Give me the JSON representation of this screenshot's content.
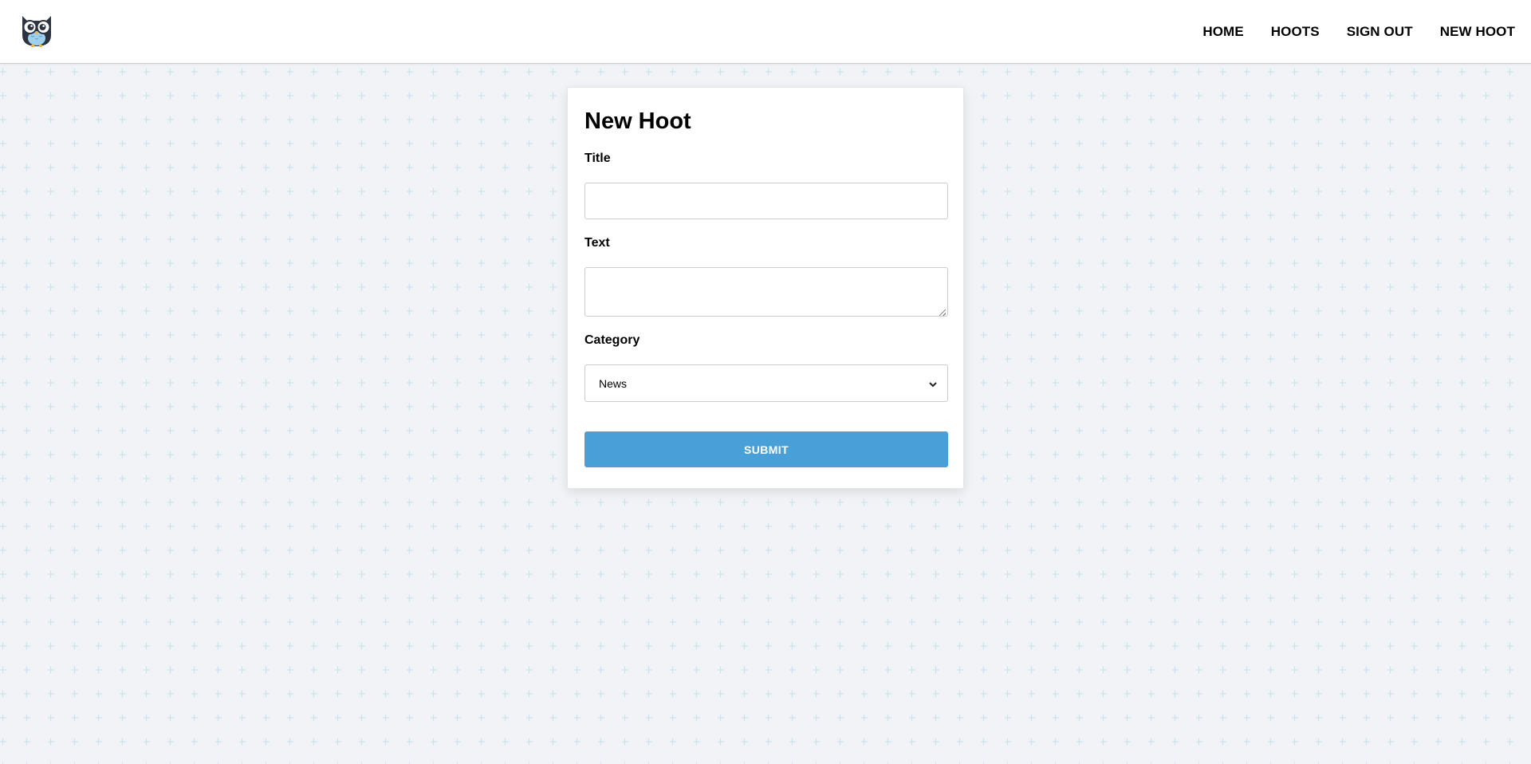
{
  "nav": {
    "items": [
      {
        "label": "HOME"
      },
      {
        "label": "HOOTS"
      },
      {
        "label": "SIGN OUT"
      },
      {
        "label": "NEW HOOT"
      }
    ]
  },
  "form": {
    "title": "New Hoot",
    "title_label": "Title",
    "title_value": "",
    "text_label": "Text",
    "text_value": "",
    "category_label": "Category",
    "category_selected": "News",
    "submit_label": "SUBMIT"
  },
  "icons": {
    "logo": "owl-logo-icon",
    "select_arrow": "chevron-down-icon"
  },
  "colors": {
    "accent": "#499fd8",
    "background": "#f1f3f7",
    "pattern": "#cfe6ee"
  }
}
